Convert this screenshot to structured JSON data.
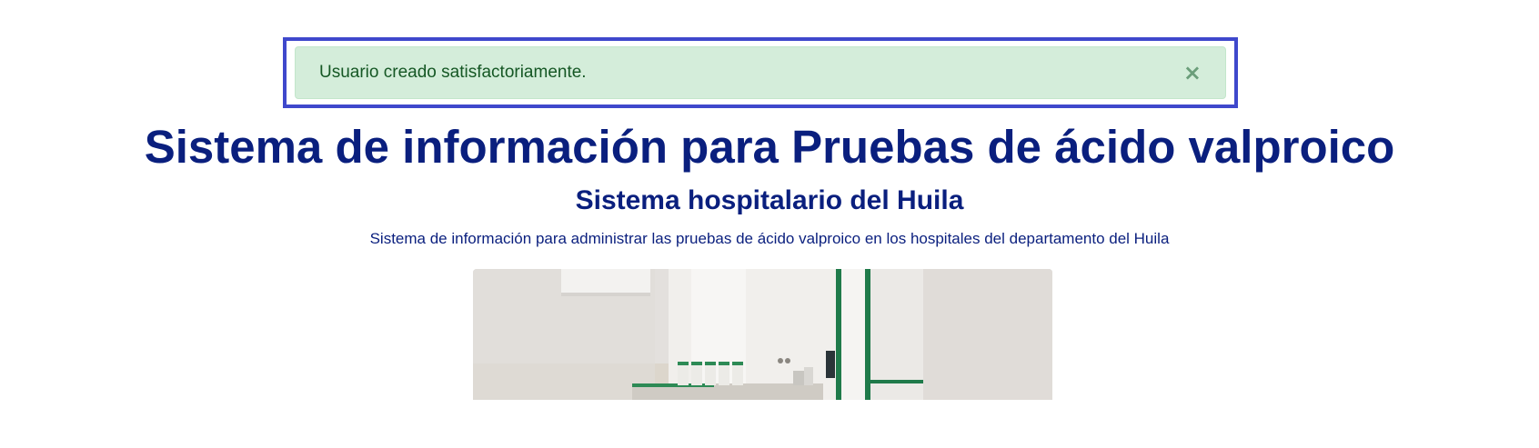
{
  "alert": {
    "message": "Usuario creado satisfactoriamente.",
    "close_symbol": "×",
    "color_bg": "#d4edda",
    "color_text": "#155724",
    "highlight_border": "#3f48cc"
  },
  "header": {
    "title": "Sistema de información para Pruebas de ácido valproico",
    "subtitle": "Sistema hospitalario del Huila",
    "description": "Sistema de información para administrar las pruebas de ácido valproico en los hospitales del departamento del Huila",
    "color_text": "#0a1f7e"
  },
  "hero": {
    "image_subject": "laboratory-room-photo"
  }
}
